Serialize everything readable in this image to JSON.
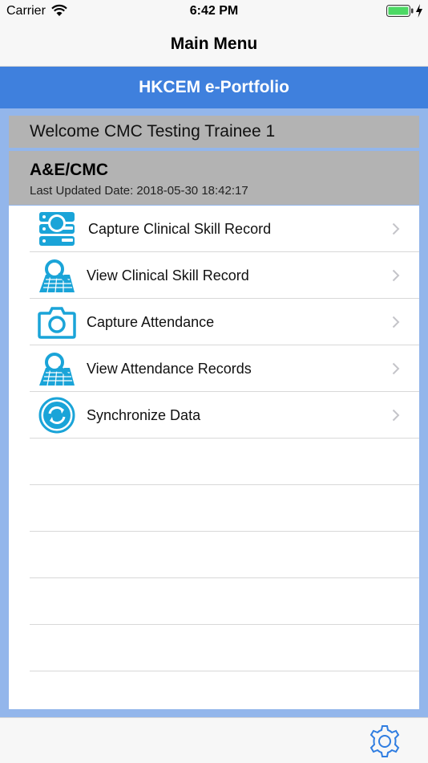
{
  "status_bar": {
    "carrier": "Carrier",
    "time": "6:42 PM",
    "wifi_icon": "wifi-icon",
    "battery_icon": "battery-icon",
    "charge_icon": "charging-bolt-icon",
    "battery_color": "#4cd964"
  },
  "nav": {
    "title": "Main Menu"
  },
  "header": {
    "banner": "HKCEM e-Portfolio",
    "banner_color": "#3f80dd"
  },
  "welcome": {
    "text": "Welcome CMC Testing Trainee 1"
  },
  "profile": {
    "name": "A&E/CMC",
    "last_updated": "Last Updated Date: 2018-05-30 18:42:17"
  },
  "menu": {
    "items": [
      {
        "label": "Capture Clinical Skill Record",
        "icon": "capture-record-icon"
      },
      {
        "label": "View Clinical Skill Record",
        "icon": "view-record-icon"
      },
      {
        "label": "Capture Attendance",
        "icon": "camera-icon"
      },
      {
        "label": "View Attendance Records",
        "icon": "view-record-icon"
      },
      {
        "label": "Synchronize Data",
        "icon": "sync-icon"
      }
    ],
    "icon_color": "#1aa4d8"
  },
  "toolbar": {
    "settings_icon": "gear-icon"
  }
}
